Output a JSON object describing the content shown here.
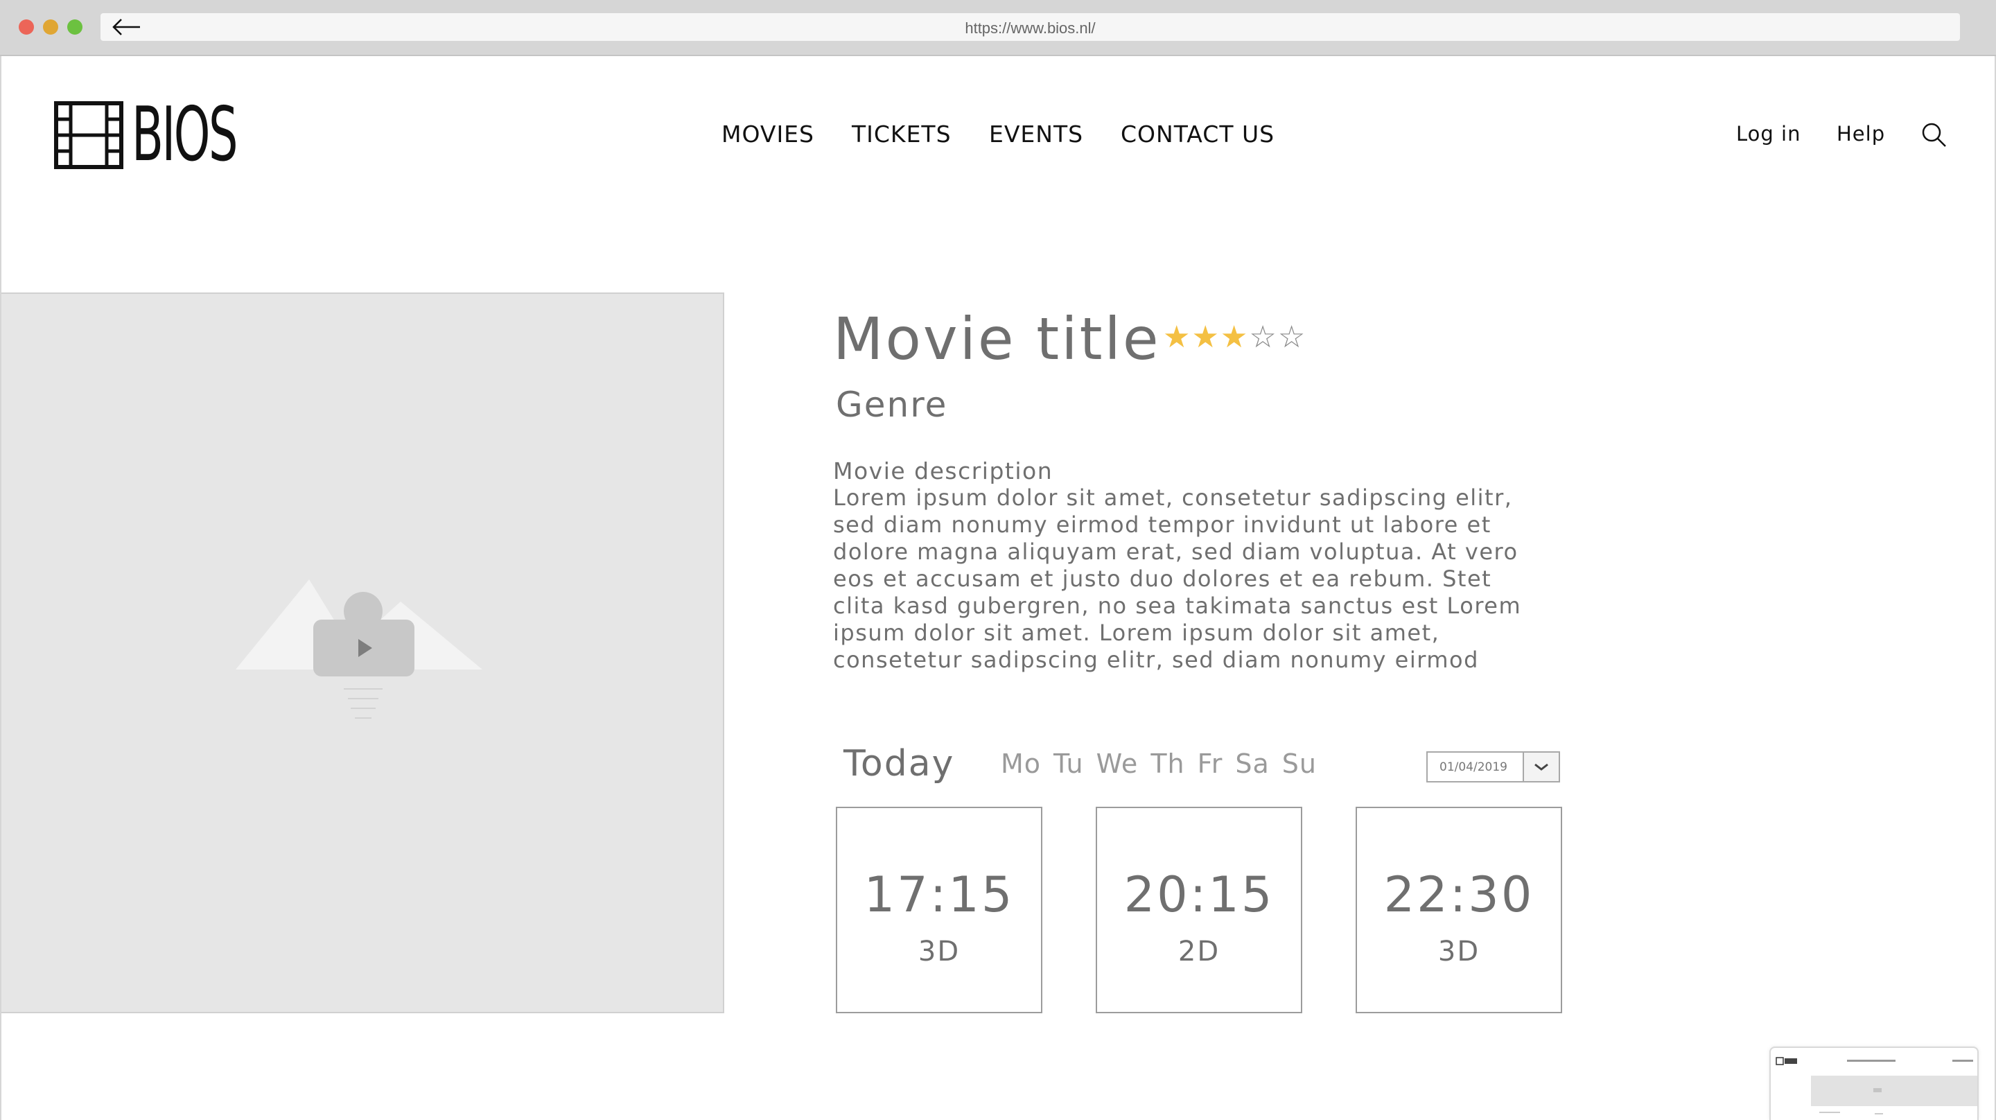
{
  "browser": {
    "url": "https://www.bios.nl/",
    "icons": [
      "close-dot",
      "minimize-dot",
      "maximize-dot",
      "back-arrow-icon"
    ]
  },
  "header": {
    "logo_text": "BIOS",
    "logo_icon": "film-strip-icon",
    "nav": {
      "movies": "MOVIES",
      "tickets": "TICKETS",
      "events": "EVENTS",
      "contact": "CONTACT US"
    },
    "login": "Log in",
    "help": "Help",
    "search_icon": "search-icon"
  },
  "media": {
    "icon": "video-play-placeholder-icon"
  },
  "movie": {
    "title": "Movie title",
    "rating": 3,
    "rating_max": 5,
    "genre": "Genre",
    "description_title": "Movie description",
    "description": "Lorem ipsum dolor sit amet, consetetur sadipscing elitr, sed diam nonumy eirmod tempor invidunt ut labore et dolore magna aliquyam erat, sed diam voluptua. At vero eos et accusam et justo duo dolores et ea rebum. Stet clita kasd gubergren, no sea takimata sanctus est Lorem ipsum dolor sit amet. Lorem ipsum dolor sit amet, consetetur sadipscing elitr, sed diam nonumy eirmod"
  },
  "schedule": {
    "today_label": "Today",
    "days": [
      "Mo",
      "Tu",
      "We",
      "Th",
      "Fr",
      "Sa",
      "Su"
    ],
    "date_value": "01/04/2019",
    "showtimes": [
      {
        "time": "17:15",
        "format": "3D"
      },
      {
        "time": "20:15",
        "format": "2D"
      },
      {
        "time": "22:30",
        "format": "3D"
      }
    ]
  },
  "colors": {
    "star_filled": "#f4c043",
    "text_gray": "#6f6f6f",
    "placeholder_bg": "#e6e6e6"
  }
}
